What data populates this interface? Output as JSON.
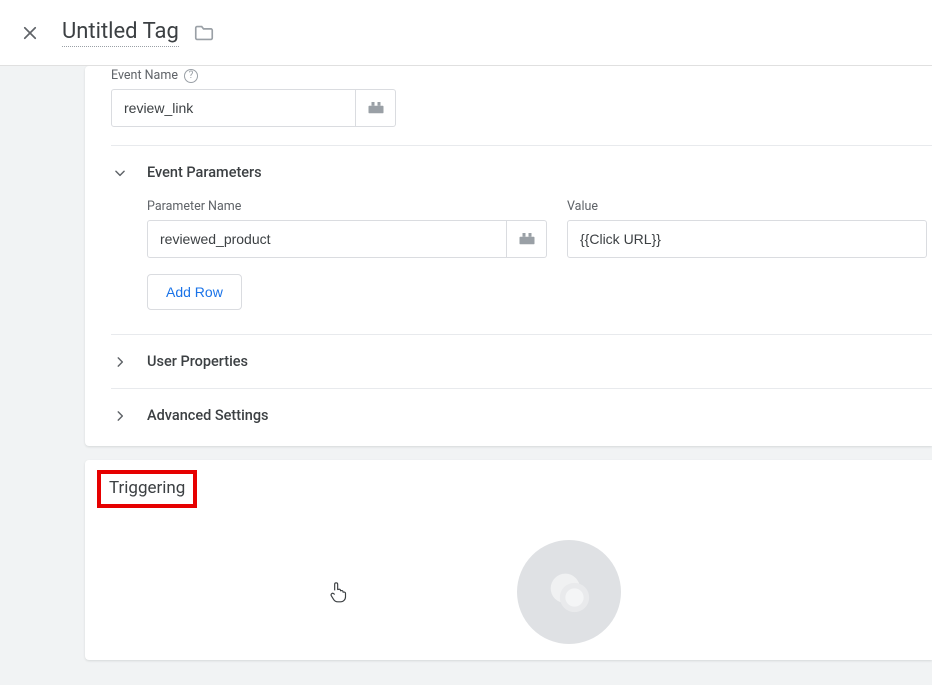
{
  "header": {
    "title": "Untitled Tag"
  },
  "config": {
    "event_name_label": "Event Name",
    "event_name_value": "review_link",
    "event_parameters_title": "Event Parameters",
    "param_name_label": "Parameter Name",
    "param_value_label": "Value",
    "params": [
      {
        "name": "reviewed_product",
        "value": "{{Click URL}}"
      }
    ],
    "add_row_label": "Add Row",
    "user_properties_title": "User Properties",
    "advanced_settings_title": "Advanced Settings"
  },
  "triggering": {
    "title": "Triggering"
  }
}
